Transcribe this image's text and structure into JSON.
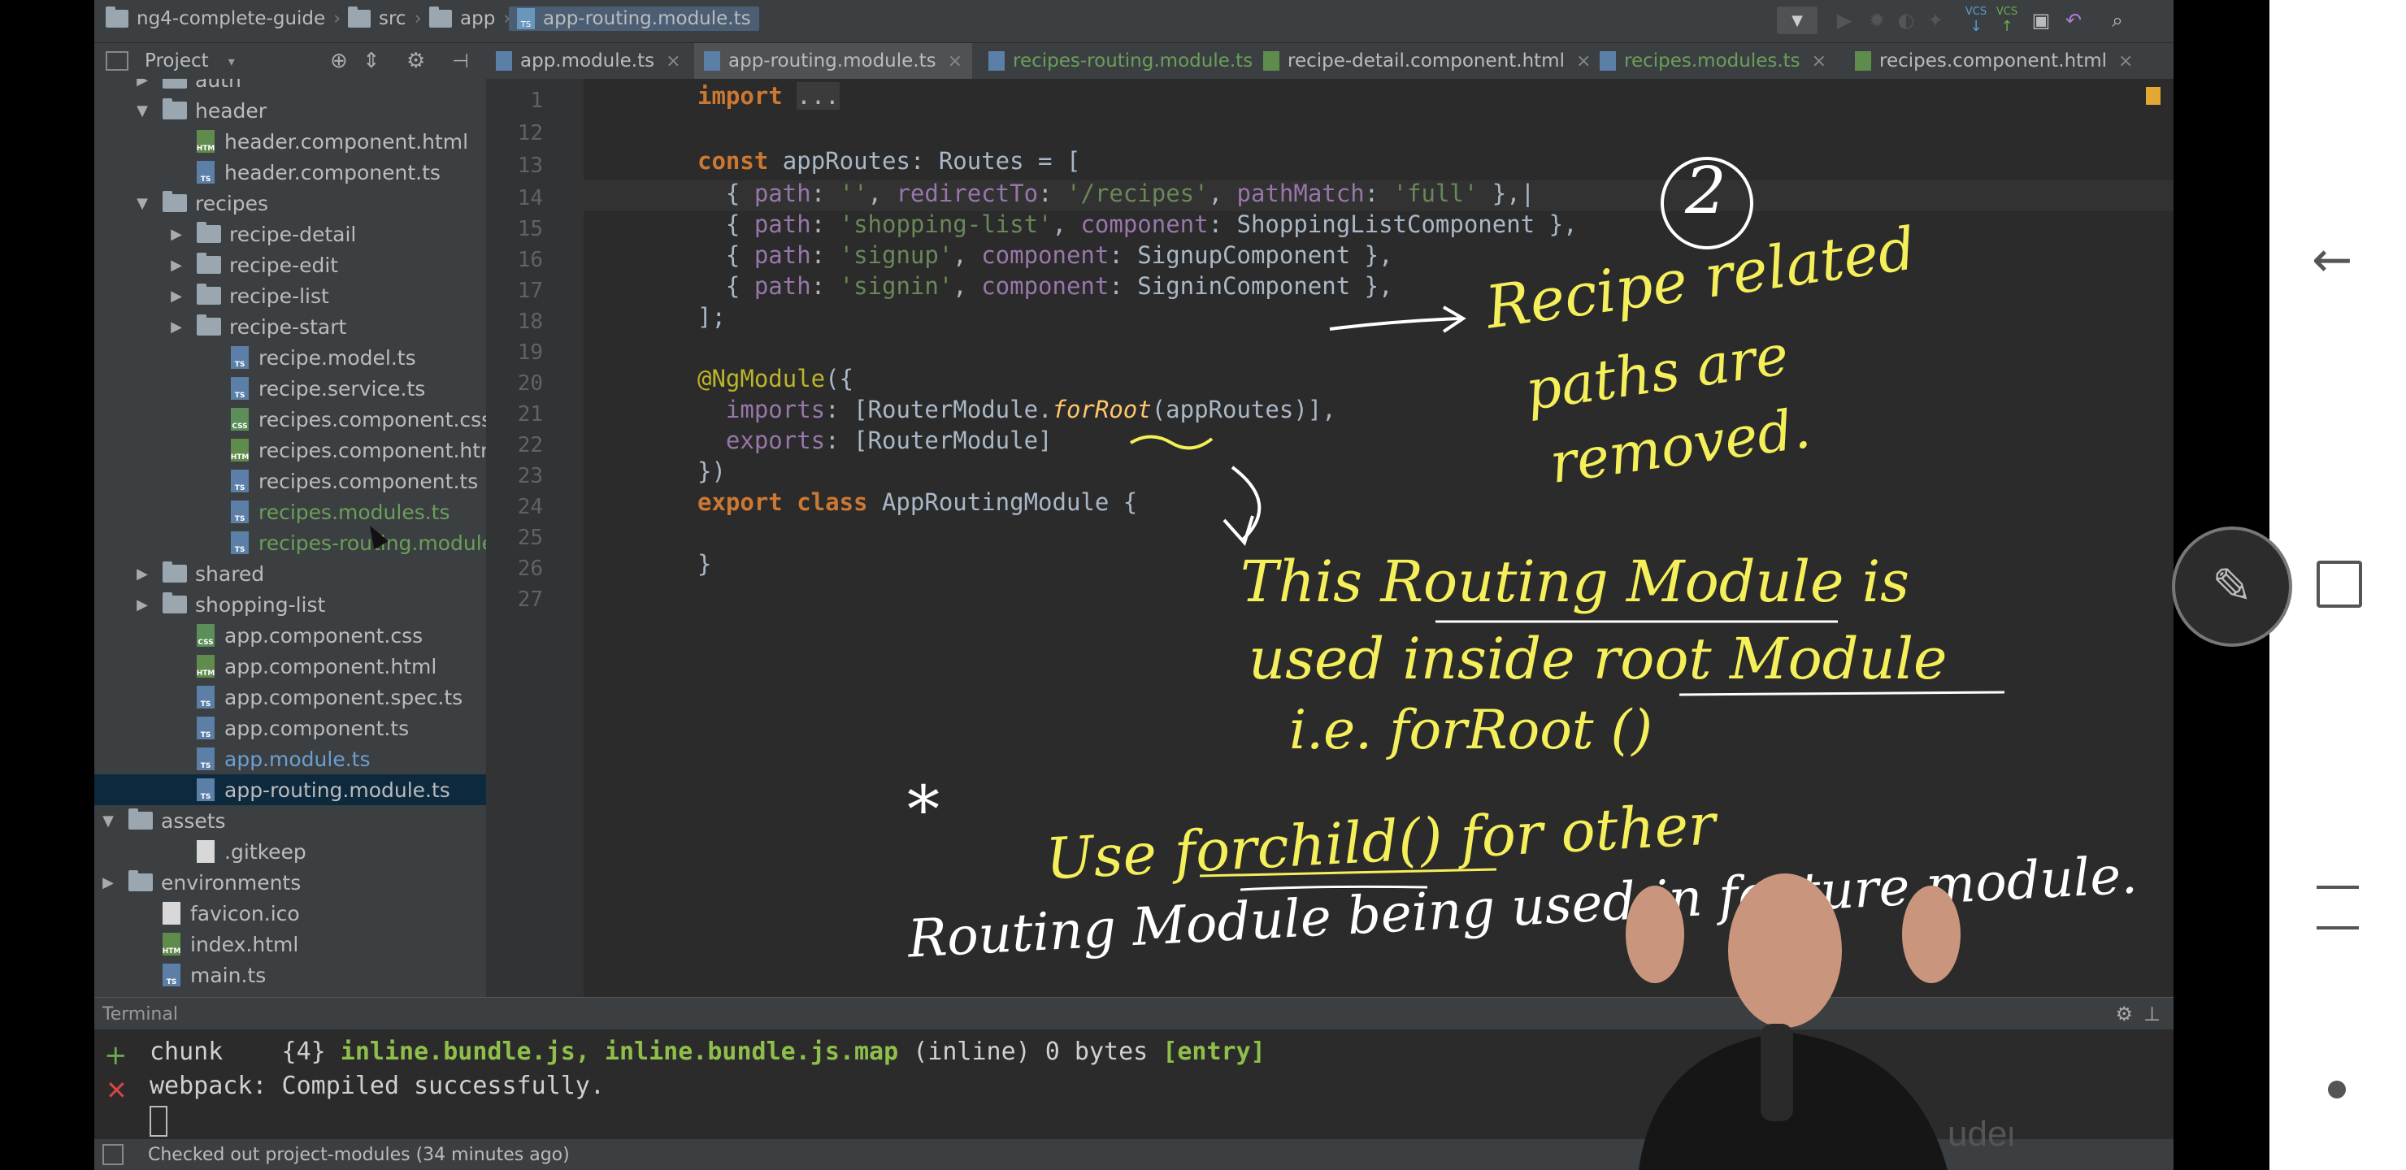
{
  "breadcrumb": [
    "ng4-complete-guide",
    "src",
    "app",
    "app-routing.module.ts"
  ],
  "project_panel": {
    "title": "Project"
  },
  "tree": [
    {
      "label": "auth",
      "type": "folder",
      "indent": 1,
      "arrow": "right"
    },
    {
      "label": "header",
      "type": "folder",
      "indent": 1,
      "arrow": "down"
    },
    {
      "label": "header.component.html",
      "type": "html",
      "indent": 2
    },
    {
      "label": "header.component.ts",
      "type": "ts",
      "indent": 2
    },
    {
      "label": "recipes",
      "type": "folder",
      "indent": 1,
      "arrow": "down"
    },
    {
      "label": "recipe-detail",
      "type": "folder",
      "indent": 2,
      "arrow": "right"
    },
    {
      "label": "recipe-edit",
      "type": "folder",
      "indent": 2,
      "arrow": "right"
    },
    {
      "label": "recipe-list",
      "type": "folder",
      "indent": 2,
      "arrow": "right"
    },
    {
      "label": "recipe-start",
      "type": "folder",
      "indent": 2,
      "arrow": "right"
    },
    {
      "label": "recipe.model.ts",
      "type": "ts",
      "indent": 3
    },
    {
      "label": "recipe.service.ts",
      "type": "ts",
      "indent": 3
    },
    {
      "label": "recipes.component.css",
      "type": "css",
      "indent": 3
    },
    {
      "label": "recipes.component.html",
      "type": "html",
      "indent": 3
    },
    {
      "label": "recipes.component.ts",
      "type": "ts",
      "indent": 3
    },
    {
      "label": "recipes.modules.ts",
      "type": "ts",
      "indent": 3,
      "color": "green"
    },
    {
      "label": "recipes-routing.module.ts",
      "type": "ts",
      "indent": 3,
      "color": "green"
    },
    {
      "label": "shared",
      "type": "folder",
      "indent": 1,
      "arrow": "right"
    },
    {
      "label": "shopping-list",
      "type": "folder",
      "indent": 1,
      "arrow": "right"
    },
    {
      "label": "app.component.css",
      "type": "css",
      "indent": 2
    },
    {
      "label": "app.component.html",
      "type": "html",
      "indent": 2
    },
    {
      "label": "app.component.spec.ts",
      "type": "ts",
      "indent": 2
    },
    {
      "label": "app.component.ts",
      "type": "ts",
      "indent": 2
    },
    {
      "label": "app.module.ts",
      "type": "ts",
      "indent": 2,
      "color": "blue"
    },
    {
      "label": "app-routing.module.ts",
      "type": "ts",
      "indent": 2,
      "selected": true
    },
    {
      "label": "assets",
      "type": "folder",
      "indent": 0,
      "arrow": "down"
    },
    {
      "label": ".gitkeep",
      "type": "plain",
      "indent": 2
    },
    {
      "label": "environments",
      "type": "folder",
      "indent": 0,
      "arrow": "right"
    },
    {
      "label": "favicon.ico",
      "type": "plain",
      "indent": 1
    },
    {
      "label": "index.html",
      "type": "html",
      "indent": 1
    },
    {
      "label": "main.ts",
      "type": "ts",
      "indent": 1
    }
  ],
  "tabs": [
    {
      "label": "app.module.ts",
      "icon": "ts"
    },
    {
      "label": "app-routing.module.ts",
      "icon": "ts",
      "active": true
    },
    {
      "label": "recipes-routing.module.ts",
      "icon": "ts",
      "color": "green"
    },
    {
      "label": "recipe-detail.component.html",
      "icon": "html"
    },
    {
      "label": "recipes.modules.ts",
      "icon": "ts",
      "color": "green"
    },
    {
      "label": "recipes.component.html",
      "icon": "html"
    }
  ],
  "code": {
    "line_numbers": [
      "1",
      "12",
      "13",
      "14",
      "15",
      "16",
      "17",
      "18",
      "19",
      "20",
      "21",
      "22",
      "23",
      "24",
      "25",
      "26",
      "27"
    ]
  },
  "annotations": {
    "circled_number": "2",
    "recipe_note_1": "Recipe related",
    "recipe_note_2": "paths are",
    "recipe_note_3": "removed.",
    "module_note_1": "This Routing Module is",
    "module_note_2": "used inside root Module",
    "module_note_3": "i.e. forRoot ()",
    "star": "*",
    "child_note_1": "Use forchild() for other",
    "child_note_2": "Routing Module being used in feature module."
  },
  "terminal": {
    "title": "Terminal",
    "line1_prefix": "chunk    {4} ",
    "line1_bold": "inline.bundle.js, inline.bundle.js.map",
    "line1_mid": " (inline) 0 bytes ",
    "line1_tail": "[entry]",
    "line2": "webpack: Compiled successfully."
  },
  "status_bar": {
    "text": "Checked out project-modules (34 minutes ago)"
  },
  "watermark": "udemy"
}
